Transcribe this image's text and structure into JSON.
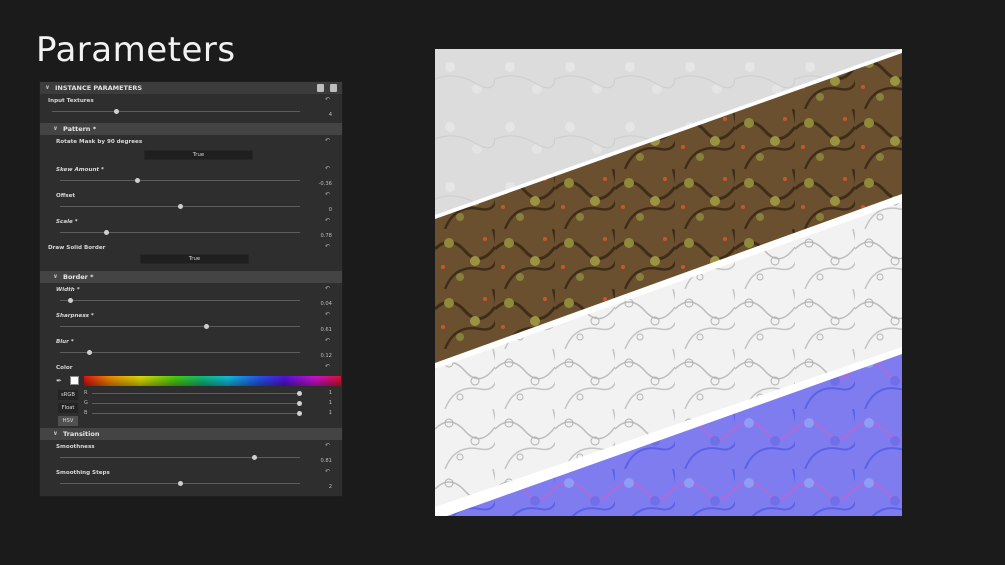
{
  "title": "Parameters",
  "panel": {
    "header": "INSTANCE PARAMETERS",
    "reset_glyph": "↶",
    "input_textures": {
      "label": "Input Textures",
      "value": "4",
      "fraction": 0.26
    },
    "pattern": {
      "title": "Pattern *",
      "rotate_mask": {
        "label": "Rotate Mask by 90 degrees",
        "value": "True"
      },
      "skew_amount": {
        "label": "Skew Amount *",
        "value": "-0.36",
        "fraction": 0.32
      },
      "offset": {
        "label": "Offset",
        "value": "0",
        "fraction": 0.5
      },
      "scale": {
        "label": "Scale *",
        "value": "0.78",
        "fraction": 0.19
      },
      "draw_solid_border": {
        "label": "Draw Solid Border",
        "value": "True"
      }
    },
    "border": {
      "title": "Border *",
      "width": {
        "label": "Width *",
        "value": "0.04",
        "fraction": 0.04
      },
      "sharpness": {
        "label": "Sharpness *",
        "value": "0.61",
        "fraction": 0.61
      },
      "blur": {
        "label": "Blur *",
        "value": "0.12",
        "fraction": 0.12
      },
      "color": {
        "label": "Color",
        "swatch": "#ffffff",
        "picker_icon": "eyedropper-icon",
        "modes": [
          "sRGB",
          "Float",
          "HSV"
        ],
        "channels": [
          {
            "name": "R",
            "value": "1"
          },
          {
            "name": "G",
            "value": "1"
          },
          {
            "name": "B",
            "value": "1"
          }
        ]
      }
    },
    "transition": {
      "title": "Transition",
      "smoothness": {
        "label": "Smoothness",
        "value": "0.81",
        "fraction": 0.81
      },
      "smoothing_steps": {
        "label": "Smoothing Steps",
        "value": "2",
        "fraction": 0.5
      }
    }
  },
  "preview": {
    "bands": [
      "light-grey-heightmap",
      "brown-mossy-basecolor",
      "white-ambient-occlusion",
      "blue-normal-map"
    ],
    "colors": {
      "grey": "#dcdcdc",
      "brown": "#6b5030",
      "white": "#f2f2f2",
      "blue": "#7f7cf0",
      "border": "#ffffff"
    }
  }
}
